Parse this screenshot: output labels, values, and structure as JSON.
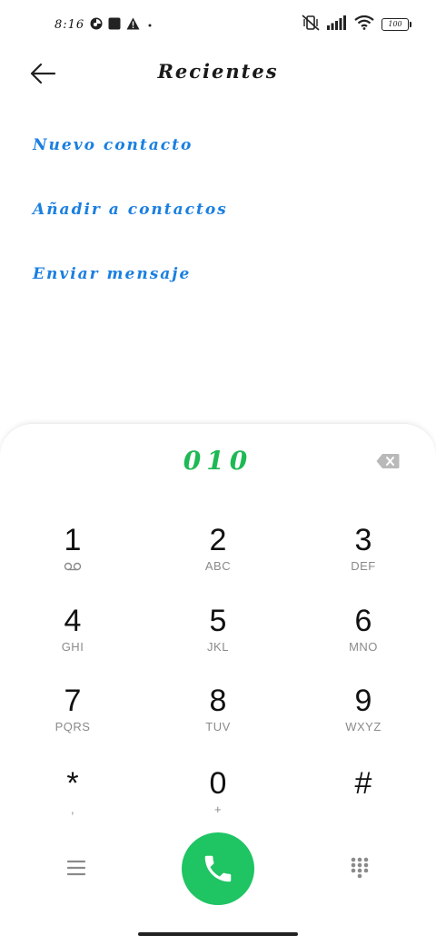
{
  "status_bar": {
    "time": "8:16",
    "battery_level": "100"
  },
  "header": {
    "title": "Recientes"
  },
  "actions": [
    {
      "label": "Nuevo contacto"
    },
    {
      "label": "Añadir a contactos"
    },
    {
      "label": "Enviar mensaje"
    }
  ],
  "dialpad": {
    "number": "010",
    "keys": [
      {
        "digit": "1",
        "letters": ""
      },
      {
        "digit": "2",
        "letters": "ABC"
      },
      {
        "digit": "3",
        "letters": "DEF"
      },
      {
        "digit": "4",
        "letters": "GHI"
      },
      {
        "digit": "5",
        "letters": "JKL"
      },
      {
        "digit": "6",
        "letters": "MNO"
      },
      {
        "digit": "7",
        "letters": "PQRS"
      },
      {
        "digit": "8",
        "letters": "TUV"
      },
      {
        "digit": "9",
        "letters": "WXYZ"
      },
      {
        "digit": "*",
        "letters": ","
      },
      {
        "digit": "0",
        "letters": "+"
      },
      {
        "digit": "#",
        "letters": ""
      }
    ]
  },
  "icons": {
    "back": "arrow-left-icon",
    "backspace": "backspace-icon",
    "voicemail": "voicemail-icon",
    "call": "phone-icon",
    "menu": "menu-icon",
    "keypad": "dialpad-icon"
  },
  "colors": {
    "accent_blue": "#1a7fe0",
    "accent_green": "#1db954",
    "call_green": "#1fc463"
  }
}
